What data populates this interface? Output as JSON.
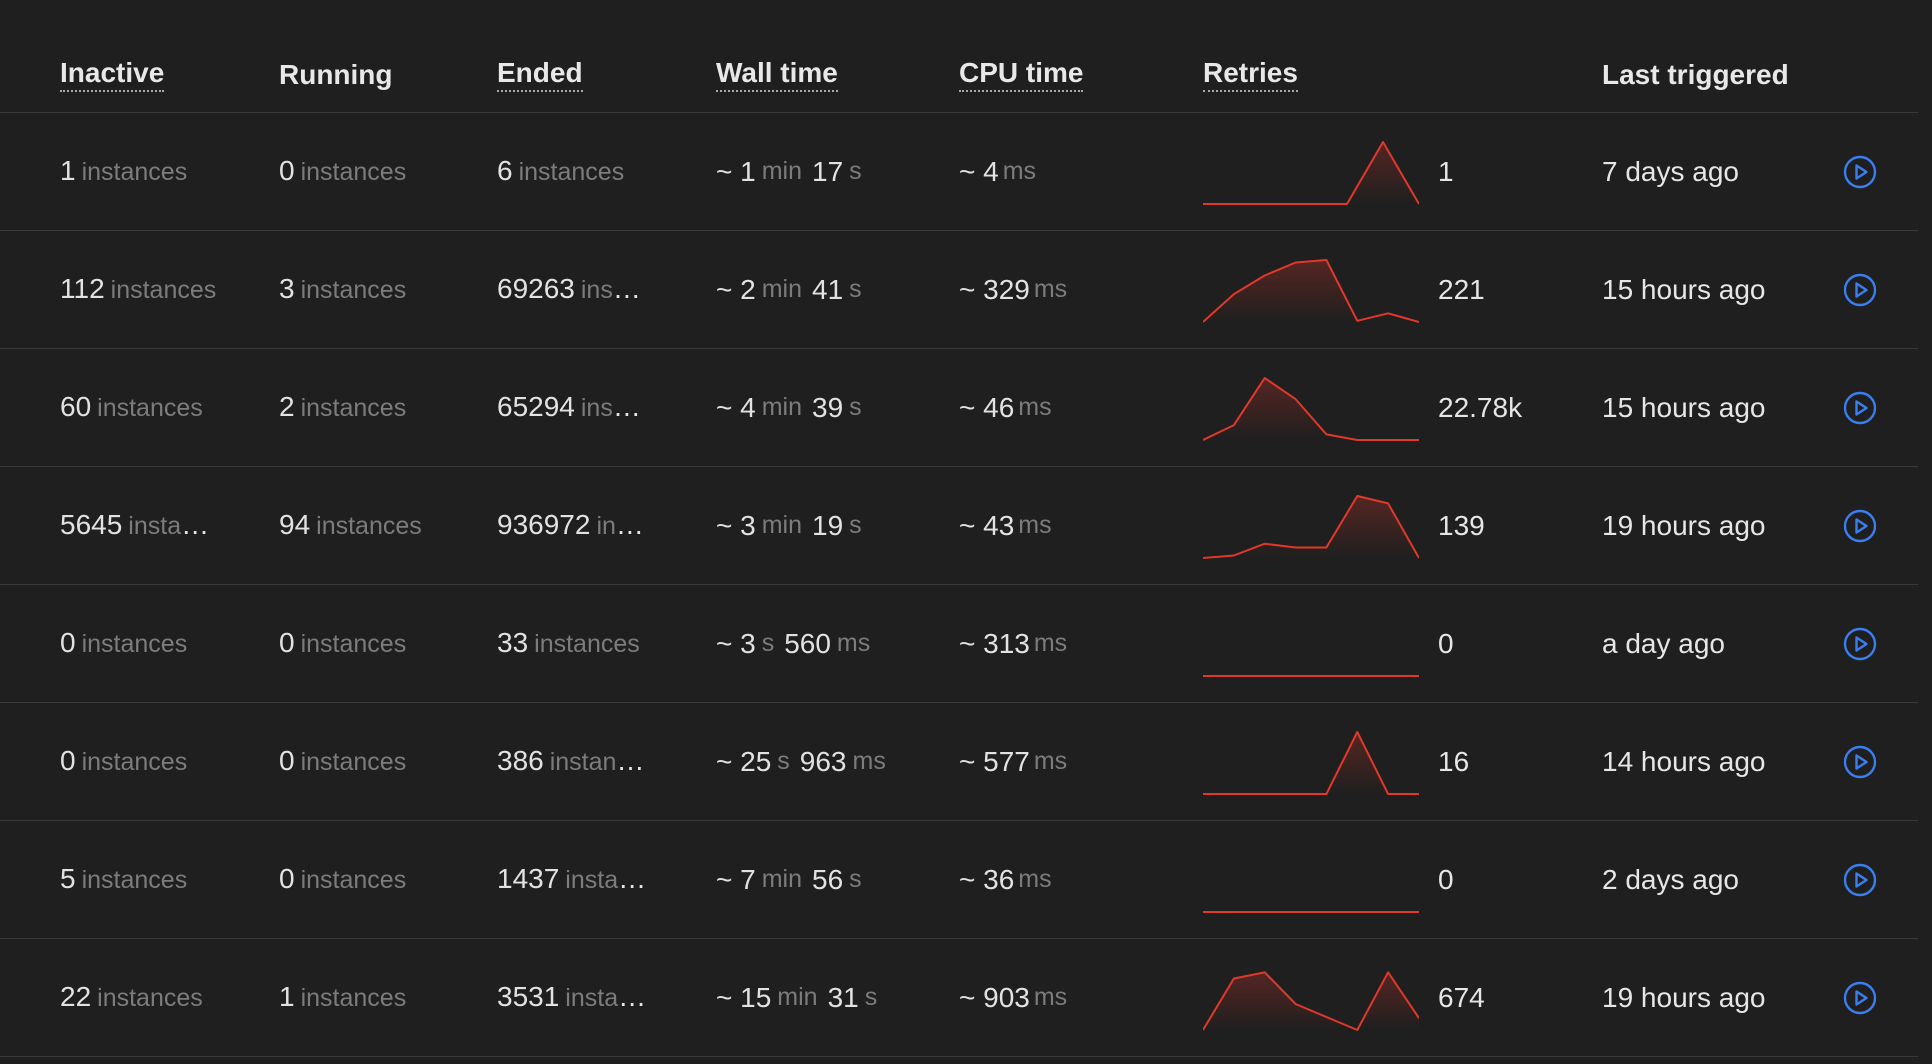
{
  "header": {
    "inactive": "Inactive",
    "running": "Running",
    "ended": "Ended",
    "wall_time": "Wall time",
    "cpu_time": "CPU time",
    "retries": "Retries",
    "last_triggered": "Last triggered"
  },
  "colors": {
    "sparkline": "#e0382b",
    "play": "#3a7ef0"
  },
  "instances_unit": "instances",
  "rows": [
    {
      "inactive": "1",
      "running": "0",
      "ended": "6",
      "wall": [
        [
          "~ 1",
          "min"
        ],
        [
          "17",
          "s"
        ]
      ],
      "cpu": [
        "~ 4",
        "ms"
      ],
      "spark": [
        0,
        0,
        0,
        0,
        0,
        1,
        0
      ],
      "retries": "1",
      "last": "7 days ago"
    },
    {
      "inactive": "112",
      "running": "3",
      "ended": "69263",
      "wall": [
        [
          "~ 2",
          "min"
        ],
        [
          "41",
          "s"
        ]
      ],
      "cpu": [
        "~ 329",
        "ms"
      ],
      "spark": [
        0.0,
        0.45,
        0.75,
        0.96,
        1.0,
        0.02,
        0.14,
        0.0
      ],
      "retries": "221",
      "last": "15 hours ago"
    },
    {
      "inactive": "60",
      "running": "2",
      "ended": "65294",
      "wall": [
        [
          "~ 4",
          "min"
        ],
        [
          "39",
          "s"
        ]
      ],
      "cpu": [
        "~ 46",
        "ms"
      ],
      "spark": [
        0.0,
        0.24,
        1.0,
        0.66,
        0.09,
        0.0,
        0.0,
        0.0
      ],
      "retries": "22.78k",
      "last": "15 hours ago"
    },
    {
      "inactive": "5645",
      "running": "94",
      "ended": "936972",
      "wall": [
        [
          "~ 3",
          "min"
        ],
        [
          "19",
          "s"
        ]
      ],
      "cpu": [
        "~ 43",
        "ms"
      ],
      "spark": [
        0.0,
        0.04,
        0.23,
        0.17,
        0.17,
        1.0,
        0.88,
        0.0
      ],
      "retries": "139",
      "last": "19 hours ago"
    },
    {
      "inactive": "0",
      "running": "0",
      "ended": "33",
      "wall": [
        [
          "~ 3",
          "s"
        ],
        [
          "560",
          "ms"
        ]
      ],
      "cpu": [
        "~ 313",
        "ms"
      ],
      "spark": [
        0,
        0,
        0,
        0,
        0,
        0,
        0,
        0
      ],
      "retries": "0",
      "last": "a day ago"
    },
    {
      "inactive": "0",
      "running": "0",
      "ended": "386",
      "wall": [
        [
          "~ 25",
          "s"
        ],
        [
          "963",
          "ms"
        ]
      ],
      "cpu": [
        "~ 577",
        "ms"
      ],
      "spark": [
        0,
        0,
        0,
        0,
        0,
        1,
        0,
        0
      ],
      "retries": "16",
      "last": "14 hours ago"
    },
    {
      "inactive": "5",
      "running": "0",
      "ended": "1437",
      "wall": [
        [
          "~ 7",
          "min"
        ],
        [
          "56",
          "s"
        ]
      ],
      "cpu": [
        "~ 36",
        "ms"
      ],
      "spark": [
        0,
        0,
        0,
        0,
        0,
        0,
        0,
        0
      ],
      "retries": "0",
      "last": "2 days ago"
    },
    {
      "inactive": "22",
      "running": "1",
      "ended": "3531",
      "wall": [
        [
          "~ 15",
          "min"
        ],
        [
          "31",
          "s"
        ]
      ],
      "cpu": [
        "~ 903",
        "ms"
      ],
      "spark": [
        0.0,
        0.83,
        0.93,
        0.42,
        0.21,
        0.0,
        0.93,
        0.19
      ],
      "retries": "674",
      "last": "19 hours ago"
    }
  ]
}
